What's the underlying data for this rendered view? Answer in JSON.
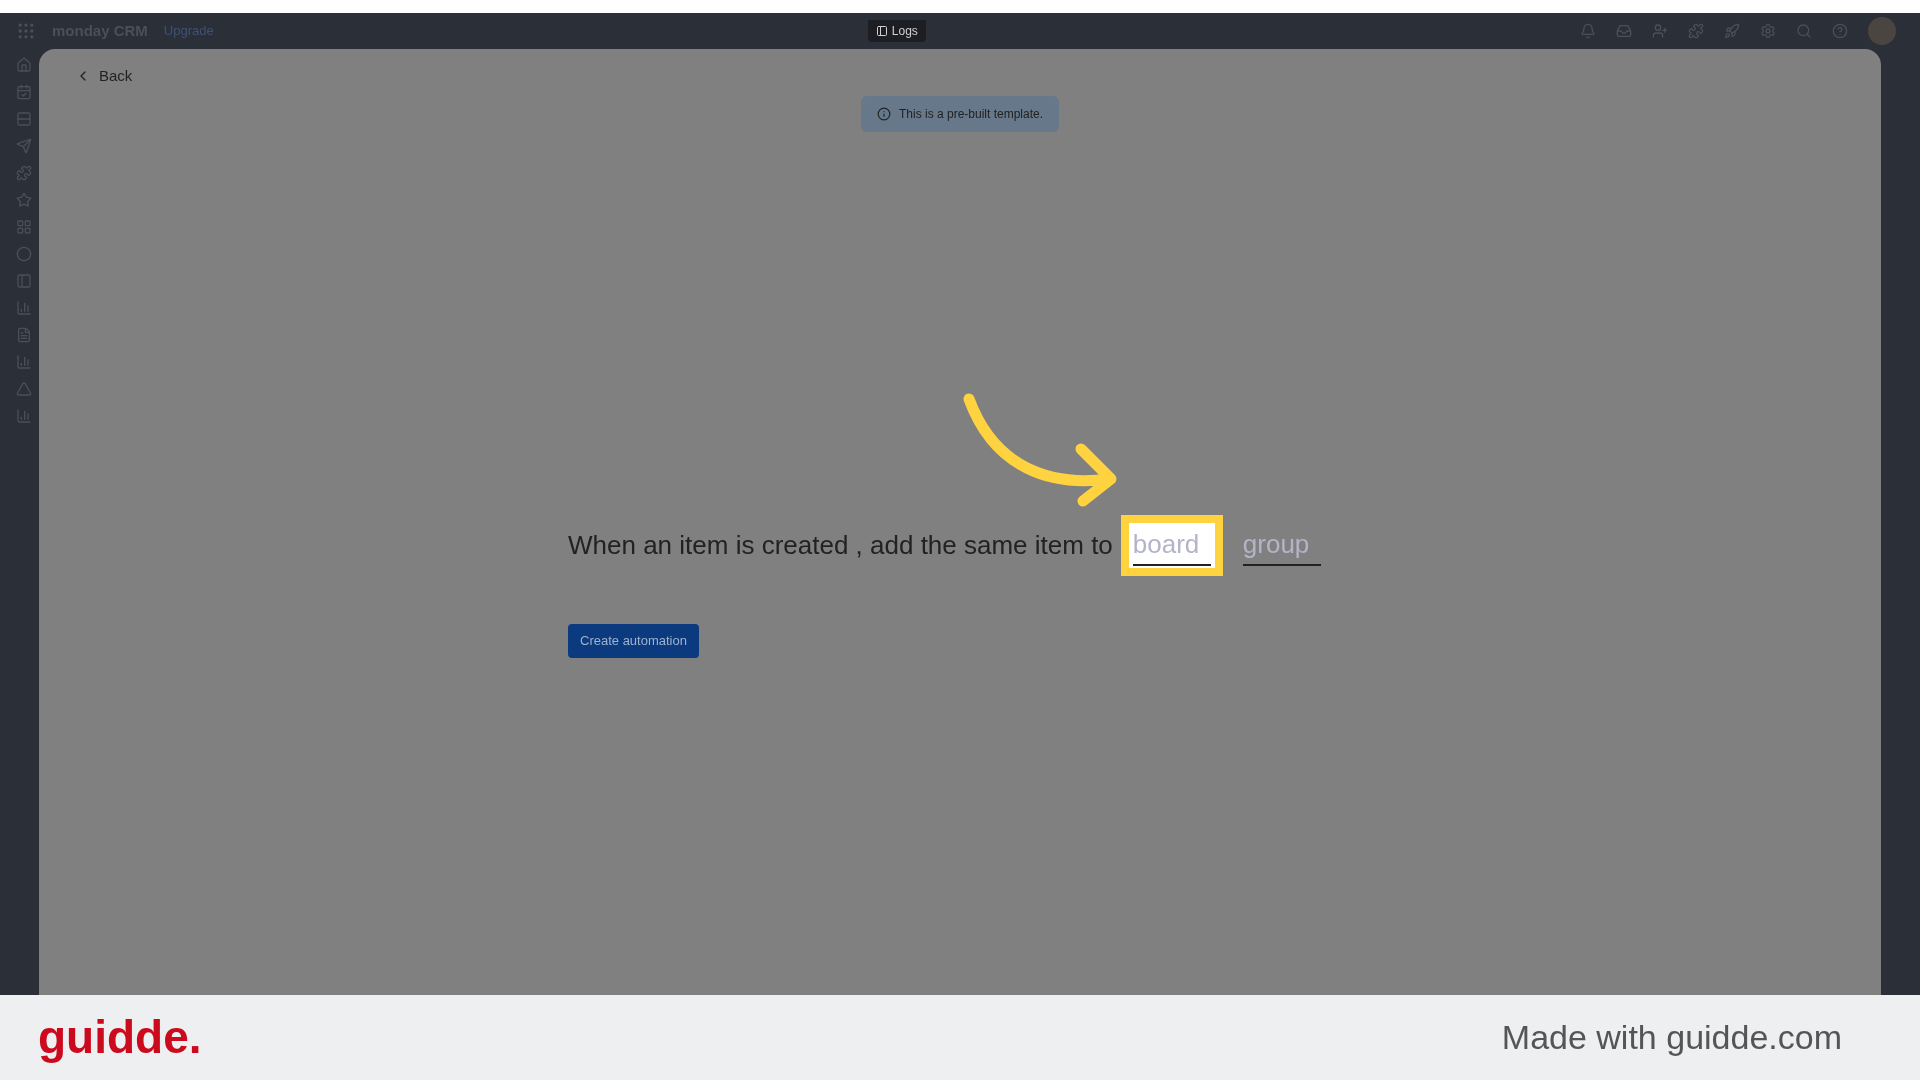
{
  "header": {
    "brand": "monday CRM",
    "upgrade": "Upgrade",
    "logs_tab": "Logs"
  },
  "modal": {
    "back": "Back",
    "notice": "This is a pre-built template.",
    "sentence": "When an item is created , add the same item to",
    "fields": [
      {
        "placeholder": "board",
        "highlighted": true
      },
      {
        "placeholder": "group",
        "highlighted": false
      }
    ],
    "button": "Create automation"
  },
  "footer": {
    "logo": "guidde.",
    "credit": "Made with guidde.com"
  }
}
